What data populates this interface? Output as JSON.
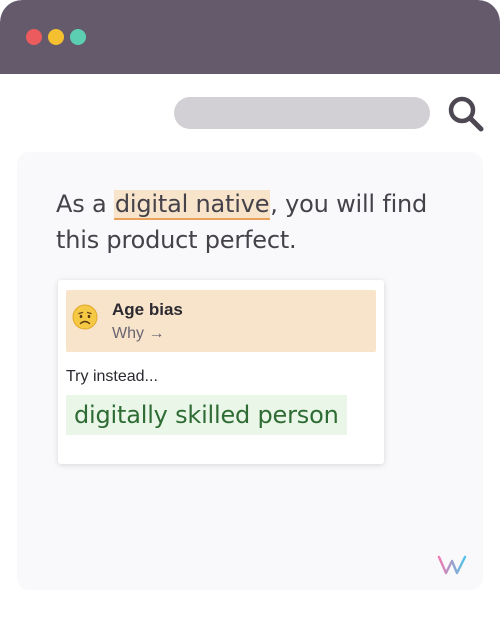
{
  "window": {
    "controls": [
      "close",
      "minimize",
      "maximize"
    ]
  },
  "search": {
    "icon": "search-icon"
  },
  "content": {
    "sentence_before": "As a ",
    "highlighted_phrase": "digital native",
    "sentence_after": ", you will find this product perfect."
  },
  "suggestion": {
    "emoji_icon": "worried-face-icon",
    "bias_title": "Age bias",
    "why_label": "Why →",
    "try_instead_label": "Try instead...",
    "replacement": "digitally skilled person"
  },
  "colors": {
    "titlebar": "#655a6c",
    "highlight_bg": "#f8e4cb",
    "highlight_underline": "#e9a15c",
    "suggestion_bg": "#eaf7e8",
    "suggestion_text": "#2f6b34"
  },
  "logo": {
    "icon": "writer-logo-icon"
  }
}
